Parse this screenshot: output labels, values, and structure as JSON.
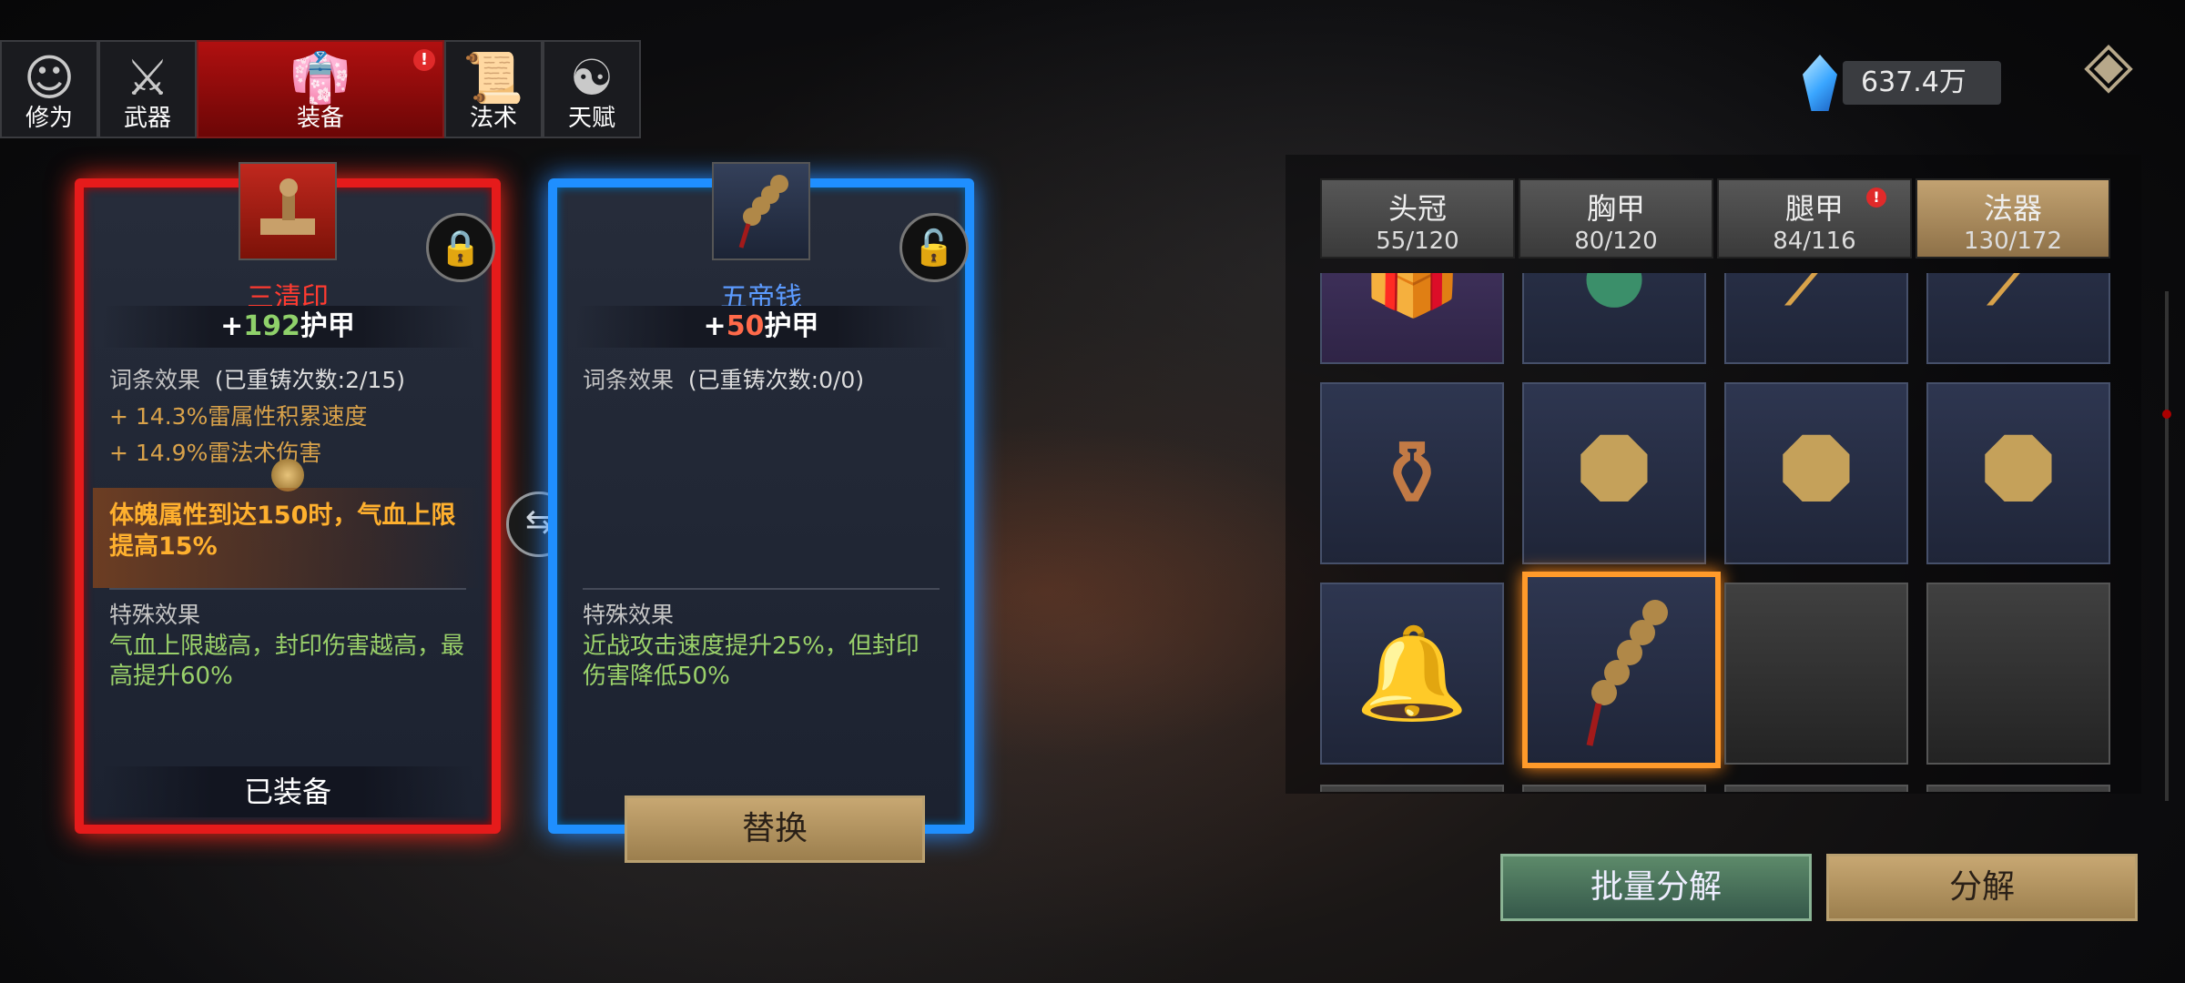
{
  "tabs": [
    {
      "label": "修为",
      "icon": "figure-icon"
    },
    {
      "label": "武器",
      "icon": "sword-icon"
    },
    {
      "label": "装备",
      "icon": "robe-icon",
      "active": true,
      "badge": "!"
    },
    {
      "label": "法术",
      "icon": "scroll-icon"
    },
    {
      "label": "天赋",
      "icon": "bagua-icon"
    }
  ],
  "currency": {
    "amount": "637.4万",
    "icon": "crystal-icon"
  },
  "left_card": {
    "name": "三清印",
    "stat_prefix": "+",
    "stat_value": "192",
    "stat_label": "护甲",
    "affix_title": "词条效果",
    "affix_count": "(已重铸次数:2/15)",
    "affix1_pct": "14.3%",
    "affix1_text": "雷属性积累速度",
    "affix2_pct": "14.9%",
    "affix2_text": "雷法术伤害",
    "plus": "+",
    "banner_text": "体魄属性到达150时，气血上限提高15%",
    "special_title": "特殊效果",
    "special_text": "气血上限越高，封印伤害越高，最高提升60%",
    "status": "已装备"
  },
  "right_card": {
    "name": "五帝钱",
    "stat_prefix": "+",
    "stat_value": "50",
    "stat_label": "护甲",
    "affix_title": "词条效果",
    "affix_count": "(已重铸次数:0/0)",
    "special_title": "特殊效果",
    "special_text": "近战攻击速度提升25%，但封印伤害降低50%",
    "replace_label": "替换"
  },
  "category_tabs": [
    {
      "name": "头冠",
      "count": "55/120"
    },
    {
      "name": "胸甲",
      "count": "80/120"
    },
    {
      "name": "腿甲",
      "count": "84/116",
      "badge": "!"
    },
    {
      "name": "法器",
      "count": "130/172",
      "active": true
    }
  ],
  "buttons": {
    "batch_decompose": "批量分解",
    "decompose": "分解"
  },
  "colors": {
    "red_frame": "#e51b1b",
    "blue_frame": "#1f8fff",
    "gold_button": "#c7a772",
    "green_button": "#5d8a6a",
    "highlight": "#ff9a2a"
  }
}
